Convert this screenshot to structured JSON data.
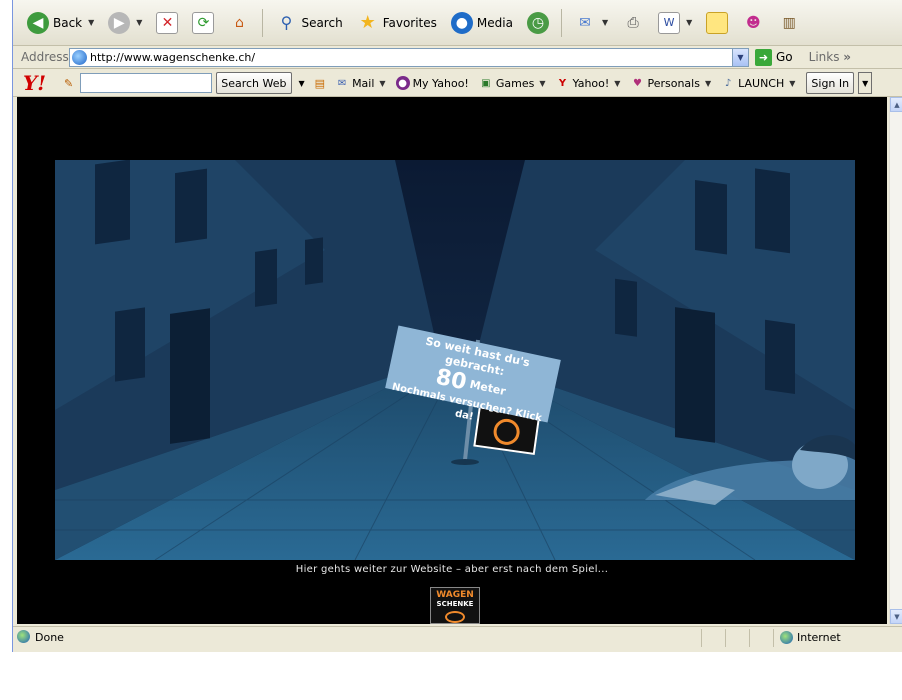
{
  "toolbar": {
    "back_label": "Back",
    "search_label": "Search",
    "favorites_label": "Favorites",
    "media_label": "Media"
  },
  "address": {
    "label": "Address",
    "url": "http://www.wagenschenke.ch/",
    "go_label": "Go",
    "links_label": "Links"
  },
  "yahoo": {
    "logo": "Y!",
    "search_value": "",
    "search_button": "Search Web",
    "items": [
      "Mail",
      "My Yahoo!",
      "Games",
      "Yahoo!",
      "Personals",
      "LAUNCH"
    ],
    "sign_in": "Sign In"
  },
  "page": {
    "logo_line1": "WAGEN",
    "logo_line2": "SCHENKE",
    "sign_line1": "So weit hast du's gebracht:",
    "distance_value": "80",
    "distance_unit": "Meter",
    "sign_line3": "Nochmals versuchen? Klick da!",
    "tagline": "Hier gehts weiter zur Website – aber erst nach dem Spiel..."
  },
  "status": {
    "text": "Done",
    "zone": "Internet"
  },
  "colors": {
    "night_sky": "#0b1a33",
    "street": "#2a6a94",
    "sign_panel": "#8fb6d6",
    "logo_orange": "#f08a2c"
  }
}
